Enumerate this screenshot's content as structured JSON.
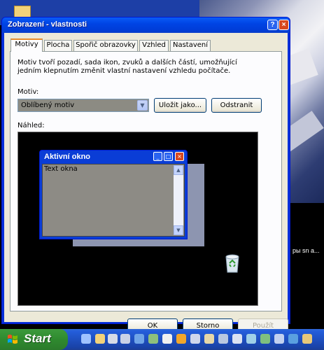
{
  "window": {
    "title": "Zobrazení - vlastnosti",
    "help_btn": "?",
    "close_btn": "×"
  },
  "tabs": [
    {
      "label": "Motivy",
      "active": true
    },
    {
      "label": "Plocha",
      "active": false
    },
    {
      "label": "Spořič obrazovky",
      "active": false
    },
    {
      "label": "Vzhled",
      "active": false
    },
    {
      "label": "Nastavení",
      "active": false
    }
  ],
  "themes_tab": {
    "description": "Motiv tvoří pozadí, sada ikon, zvuků a dalších částí, umožňující jedním klepnutím změnit vlastní nastavení vzhledu počítače.",
    "theme_label": "Motiv:",
    "theme_value": "Oblíbený motiv",
    "save_as_button": "Uložit jako...",
    "remove_button": "Odstranit",
    "preview_label": "Náhled:",
    "preview": {
      "window_title": "Aktivní okno",
      "window_text": "Text okna"
    }
  },
  "buttons": {
    "ok": "OK",
    "cancel": "Storno",
    "apply": "Použít"
  },
  "desktop": {
    "partial_text": "ры     sn а..."
  },
  "taskbar": {
    "start_label": "Start"
  },
  "colors": {
    "titlebar": "#0044e4",
    "dialog_face": "#ece9d8",
    "start_green": "#2f8a2f",
    "taskbar_blue": "#245edb",
    "active_tab_highlight": "#e68b2c"
  }
}
